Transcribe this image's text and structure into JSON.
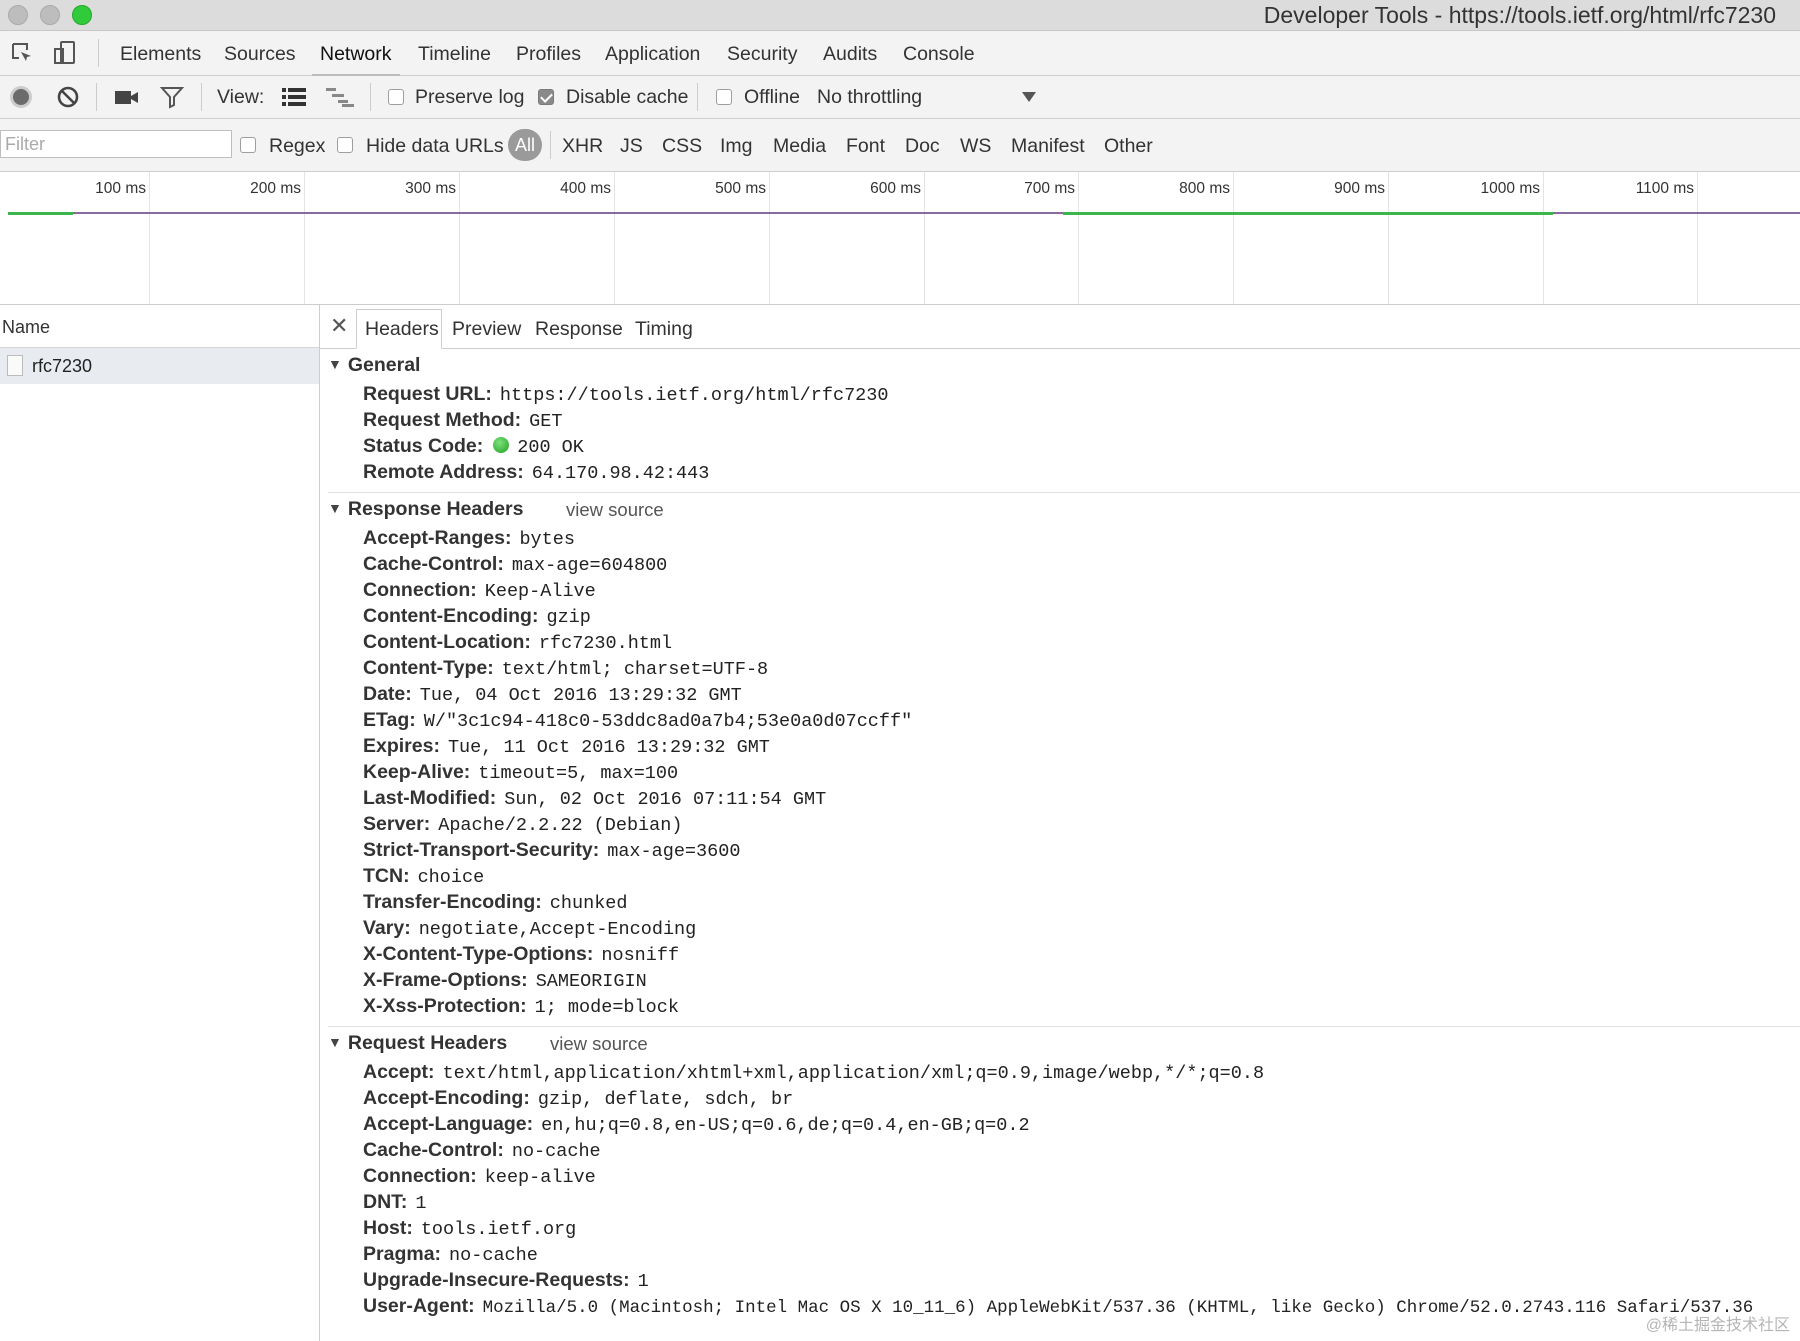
{
  "window": {
    "title": "Developer Tools - https://tools.ietf.org/html/rfc7230"
  },
  "main_tabs": [
    {
      "label": "Elements"
    },
    {
      "label": "Sources"
    },
    {
      "label": "Network",
      "active": true
    },
    {
      "label": "Timeline"
    },
    {
      "label": "Profiles"
    },
    {
      "label": "Application"
    },
    {
      "label": "Security"
    },
    {
      "label": "Audits"
    },
    {
      "label": "Console"
    }
  ],
  "network_toolbar": {
    "view_label": "View:",
    "preserve_log": {
      "label": "Preserve log",
      "checked": false
    },
    "disable_cache": {
      "label": "Disable cache",
      "checked": true
    },
    "offline": {
      "label": "Offline",
      "checked": false
    },
    "throttling": "No throttling"
  },
  "filter_bar": {
    "placeholder": "Filter",
    "regex": {
      "label": "Regex",
      "checked": false
    },
    "hide_data_urls": {
      "label": "Hide data URLs",
      "checked": false
    },
    "types": [
      "All",
      "XHR",
      "JS",
      "CSS",
      "Img",
      "Media",
      "Font",
      "Doc",
      "WS",
      "Manifest",
      "Other"
    ],
    "active_type": "All"
  },
  "overview": {
    "ticks": [
      "100 ms",
      "200 ms",
      "300 ms",
      "400 ms",
      "500 ms",
      "600 ms",
      "700 ms",
      "800 ms",
      "900 ms",
      "1000 ms",
      "1100 ms"
    ]
  },
  "requests": {
    "column_name": "Name",
    "items": [
      {
        "name": "rfc7230",
        "selected": true
      }
    ]
  },
  "detail_tabs": [
    {
      "label": "Headers",
      "active": true
    },
    {
      "label": "Preview"
    },
    {
      "label": "Response"
    },
    {
      "label": "Timing"
    }
  ],
  "general": {
    "title": "General",
    "rows": [
      {
        "key": "Request URL:",
        "value": "https://tools.ietf.org/html/rfc7230"
      },
      {
        "key": "Request Method:",
        "value": "GET"
      },
      {
        "key": "Status Code:",
        "value": "200 OK",
        "status_color": "#2eb82e"
      },
      {
        "key": "Remote Address:",
        "value": "64.170.98.42:443"
      }
    ]
  },
  "response_headers": {
    "title": "Response Headers",
    "view_source": "view source",
    "rows": [
      {
        "key": "Accept-Ranges:",
        "value": "bytes"
      },
      {
        "key": "Cache-Control:",
        "value": "max-age=604800"
      },
      {
        "key": "Connection:",
        "value": "Keep-Alive"
      },
      {
        "key": "Content-Encoding:",
        "value": "gzip"
      },
      {
        "key": "Content-Location:",
        "value": "rfc7230.html"
      },
      {
        "key": "Content-Type:",
        "value": "text/html; charset=UTF-8"
      },
      {
        "key": "Date:",
        "value": "Tue, 04 Oct 2016 13:29:32 GMT"
      },
      {
        "key": "ETag:",
        "value": "W/\"3c1c94-418c0-53ddc8ad0a7b4;53e0a0d07ccff\""
      },
      {
        "key": "Expires:",
        "value": "Tue, 11 Oct 2016 13:29:32 GMT"
      },
      {
        "key": "Keep-Alive:",
        "value": "timeout=5, max=100"
      },
      {
        "key": "Last-Modified:",
        "value": "Sun, 02 Oct 2016 07:11:54 GMT"
      },
      {
        "key": "Server:",
        "value": "Apache/2.2.22 (Debian)"
      },
      {
        "key": "Strict-Transport-Security:",
        "value": "max-age=3600"
      },
      {
        "key": "TCN:",
        "value": "choice"
      },
      {
        "key": "Transfer-Encoding:",
        "value": "chunked"
      },
      {
        "key": "Vary:",
        "value": "negotiate,Accept-Encoding"
      },
      {
        "key": "X-Content-Type-Options:",
        "value": "nosniff"
      },
      {
        "key": "X-Frame-Options:",
        "value": "SAMEORIGIN"
      },
      {
        "key": "X-Xss-Protection:",
        "value": "1; mode=block"
      }
    ]
  },
  "request_headers": {
    "title": "Request Headers",
    "view_source": "view source",
    "rows": [
      {
        "key": "Accept:",
        "value": "text/html,application/xhtml+xml,application/xml;q=0.9,image/webp,*/*;q=0.8"
      },
      {
        "key": "Accept-Encoding:",
        "value": "gzip, deflate, sdch, br"
      },
      {
        "key": "Accept-Language:",
        "value": "en,hu;q=0.8,en-US;q=0.6,de;q=0.4,en-GB;q=0.2"
      },
      {
        "key": "Cache-Control:",
        "value": "no-cache"
      },
      {
        "key": "Connection:",
        "value": "keep-alive"
      },
      {
        "key": "DNT:",
        "value": "1"
      },
      {
        "key": "Host:",
        "value": "tools.ietf.org"
      },
      {
        "key": "Pragma:",
        "value": "no-cache"
      },
      {
        "key": "Upgrade-Insecure-Requests:",
        "value": "1"
      },
      {
        "key": "User-Agent:",
        "value": "Mozilla/5.0 (Macintosh; Intel Mac OS X 10_11_6) AppleWebKit/537.36 (KHTML, like Gecko) Chrome/52.0.2743.116 Safari/537.36"
      }
    ]
  },
  "watermark": "@稀土掘金技术社区"
}
